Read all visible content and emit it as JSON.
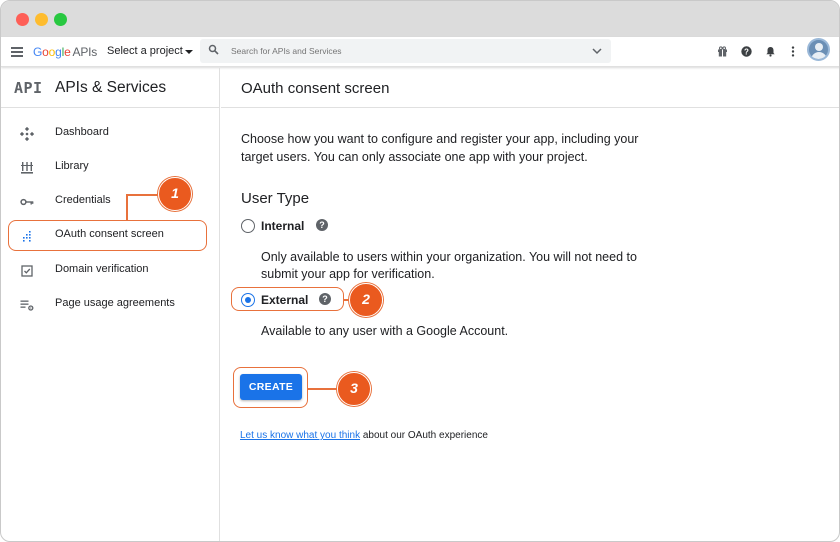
{
  "topbar": {
    "logo": {
      "letters": [
        "G",
        "o",
        "o",
        "g",
        "l",
        "e"
      ],
      "suffix": "APIs"
    },
    "project_label": "Select a project",
    "search_placeholder": "Search for APIs and Services",
    "icons": [
      "gift-icon",
      "help-icon",
      "notifications-bell-icon",
      "more-vert-icon",
      "account-avatar"
    ]
  },
  "sidebar": {
    "brand": "API",
    "title": "APIs & Services",
    "items": [
      {
        "label": "Dashboard",
        "icon": "dashboard-icon"
      },
      {
        "label": "Library",
        "icon": "library-icon"
      },
      {
        "label": "Credentials",
        "icon": "key-icon"
      },
      {
        "label": "OAuth consent screen",
        "icon": "consent-screen-icon"
      },
      {
        "label": "Domain verification",
        "icon": "checkbox-icon"
      },
      {
        "label": "Page usage agreements",
        "icon": "settings-list-icon"
      }
    ]
  },
  "main": {
    "title": "OAuth consent screen",
    "intro": "Choose how you want to configure and register your app, including your target users. You can only associate one app with your project.",
    "user_type_heading": "User Type",
    "options": [
      {
        "label": "Internal",
        "selected": false,
        "description": "Only available to users within your organization. You will not need to submit your app for verification."
      },
      {
        "label": "External",
        "selected": true,
        "description": "Available to any user with a Google Account."
      }
    ],
    "create_button": "CREATE",
    "feedback_link": "Let us know what you think",
    "feedback_suffix": " about our OAuth experience"
  },
  "annotations": {
    "badges": [
      "1",
      "2",
      "3"
    ],
    "accent_color": "#ea5a1f"
  },
  "colors": {
    "primary_blue": "#1a73e8",
    "titlebar": "#dcdcdc",
    "traffic_lights": [
      "#fe5f57",
      "#febc2e",
      "#28c840"
    ]
  }
}
